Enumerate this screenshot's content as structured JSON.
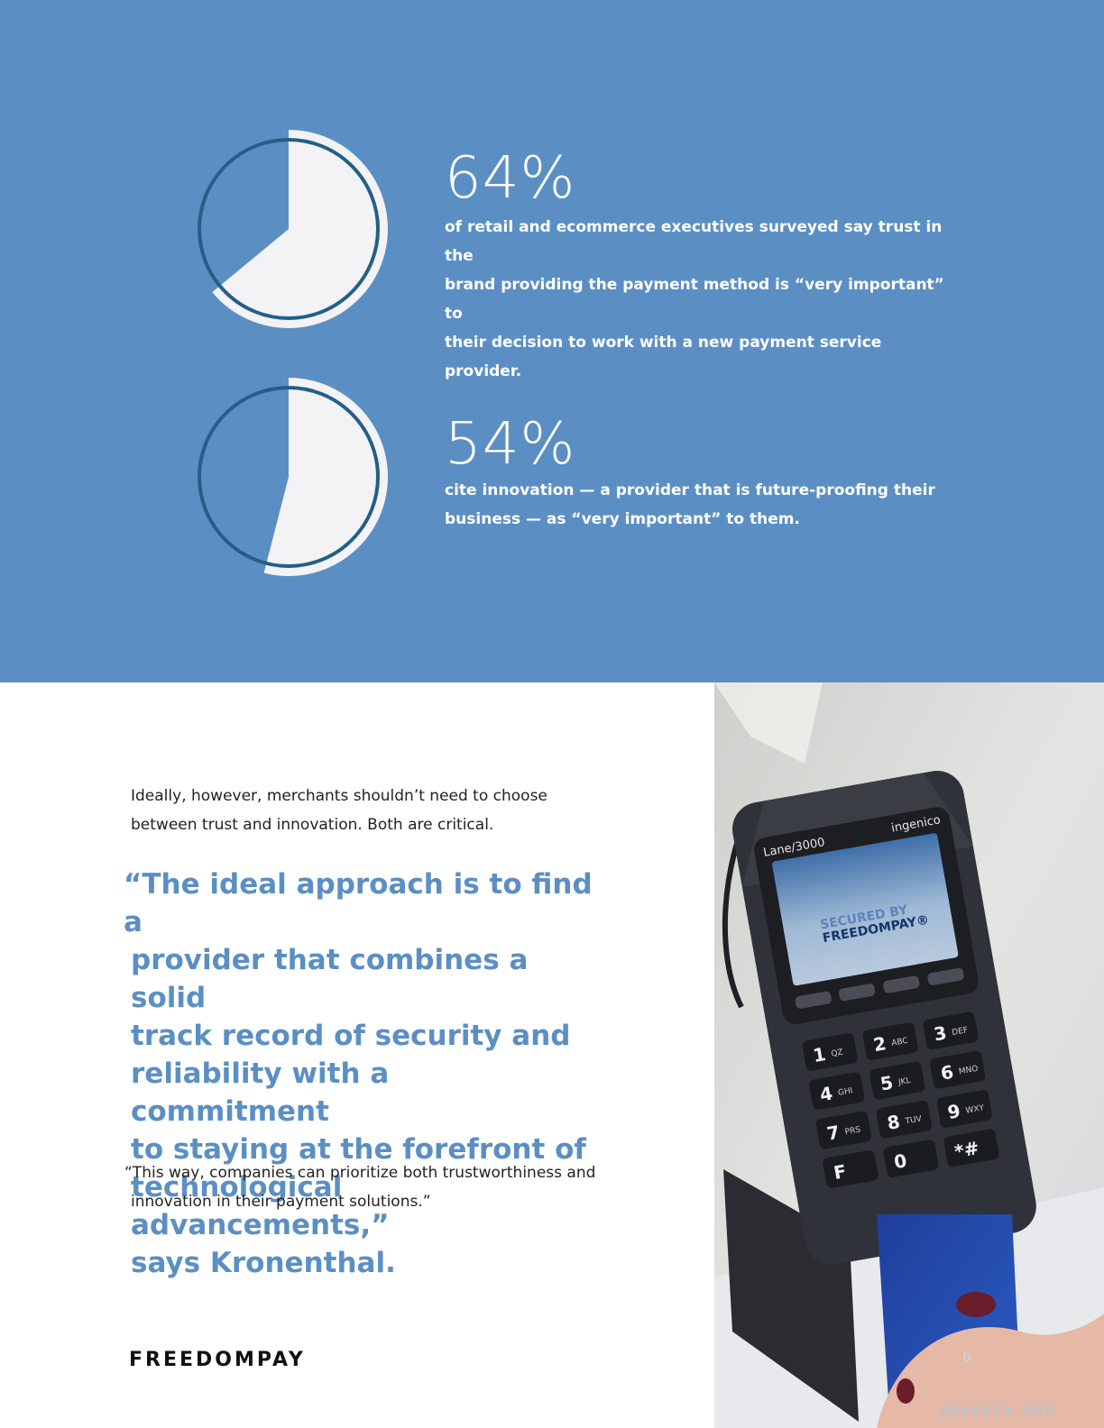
{
  "stats": [
    {
      "value": "64%",
      "fraction": 0.64,
      "lines": [
        "of retail and ecommerce executives surveyed say trust in the",
        "brand providing the payment method is “very important” to",
        "their decision to work with a new payment service provider."
      ]
    },
    {
      "value": "54%",
      "fraction": 0.54,
      "lines": [
        "cite innovation — a provider that is future-proofing their",
        "business — as “very important” to them."
      ]
    }
  ],
  "intro": {
    "lines": [
      "Ideally, however, merchants shouldn’t need to choose",
      "between trust and innovation. Both are critical."
    ]
  },
  "quote": {
    "lines": [
      "“The ideal approach is to find a",
      "provider that combines a solid",
      "track record of security and",
      "reliability with a commitment",
      "to staying at the forefront of",
      "technological advancements,”",
      "says Kronenthal."
    ]
  },
  "closing": {
    "lines": [
      "“This way, companies can prioritize both trustworthiness and",
      "innovation in their payment solutions.”"
    ]
  },
  "logo": "FREEDOMPAY",
  "page_number": "6",
  "watermark": "ABNASIA.ORG",
  "photo": {
    "terminal_model": "Lane/3000",
    "terminal_brand": "ingenico",
    "screen_line1": "SECURED BY",
    "screen_line2": "FREEDOMPAY®",
    "keys": [
      {
        "num": "1",
        "letters": "QZ"
      },
      {
        "num": "2",
        "letters": "ABC"
      },
      {
        "num": "3",
        "letters": "DEF"
      },
      {
        "num": "4",
        "letters": "GHI"
      },
      {
        "num": "5",
        "letters": "JKL"
      },
      {
        "num": "6",
        "letters": "MNO"
      },
      {
        "num": "7",
        "letters": "PRS"
      },
      {
        "num": "8",
        "letters": "TUV"
      },
      {
        "num": "9",
        "letters": "WXY"
      },
      {
        "num": "F",
        "letters": ""
      },
      {
        "num": "0",
        "letters": ""
      },
      {
        "num": "*#",
        "letters": ""
      }
    ]
  },
  "colors": {
    "band": "#5b8fc4",
    "pie_fill": "#f3f2f5",
    "ring": "#235f86",
    "quote": "#5b8fc4"
  }
}
